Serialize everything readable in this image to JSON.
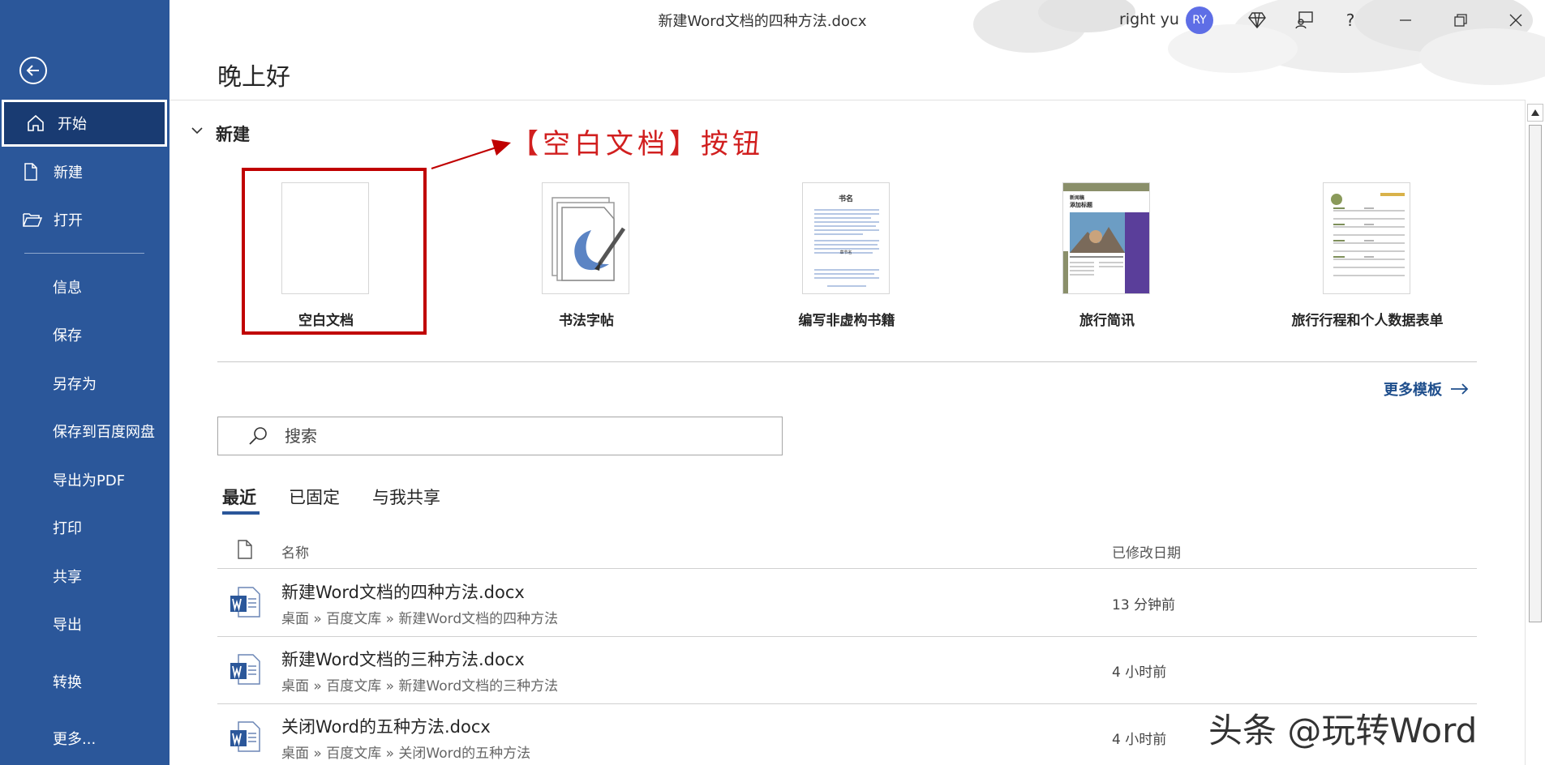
{
  "window": {
    "title": "新建Word文档的四种方法.docx",
    "user_name": "right yu",
    "user_initials": "RY"
  },
  "sidebar": {
    "items": [
      {
        "label": "开始",
        "icon": "home-icon"
      },
      {
        "label": "新建",
        "icon": "new-document-icon"
      },
      {
        "label": "打开",
        "icon": "open-folder-icon"
      },
      {
        "label": "信息"
      },
      {
        "label": "保存"
      },
      {
        "label": "另存为"
      },
      {
        "label": "保存到百度网盘"
      },
      {
        "label": "导出为PDF"
      },
      {
        "label": "打印"
      },
      {
        "label": "共享"
      },
      {
        "label": "导出"
      },
      {
        "label": "转换"
      },
      {
        "label": "更多..."
      }
    ]
  },
  "main": {
    "greeting": "晚上好",
    "new_section": {
      "heading": "新建",
      "templates": [
        {
          "label": "空白文档"
        },
        {
          "label": "书法字帖"
        },
        {
          "label": "编写非虚构书籍",
          "thumb_title": "书名",
          "thumb_sub": "章节名"
        },
        {
          "label": "旅行简讯",
          "thumb_title": "新闻稿",
          "thumb_sub": "添加标题"
        },
        {
          "label": "旅行行程和个人数据表单"
        }
      ],
      "more_templates": "更多模板"
    },
    "annotation": "【空白文档】按钮",
    "search": {
      "placeholder": "搜索"
    },
    "tabs": [
      "最近",
      "已固定",
      "与我共享"
    ],
    "list": {
      "col_name": "名称",
      "col_date": "已修改日期",
      "files": [
        {
          "name": "新建Word文档的四种方法.docx",
          "path": "桌面 » 百度文库 » 新建Word文档的四种方法",
          "time": "13 分钟前"
        },
        {
          "name": "新建Word文档的三种方法.docx",
          "path": "桌面 » 百度文库 » 新建Word文档的三种方法",
          "time": "4 小时前"
        },
        {
          "name": "关闭Word的五种方法.docx",
          "path": "桌面 » 百度文库 » 关闭Word的五种方法",
          "time": "4 小时前"
        }
      ]
    }
  },
  "watermark": "头条 @玩转Word",
  "colors": {
    "sidebar": "#2b579a",
    "sidebar_active": "#193b72",
    "annotation": "#c00000",
    "link": "#1e4e8c"
  }
}
